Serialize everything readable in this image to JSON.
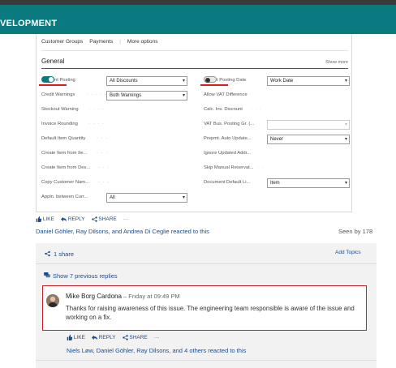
{
  "header": {
    "title": "VELOPMENT"
  },
  "card": {
    "tabs": [
      "Customer Groups",
      "Payments",
      "More options"
    ],
    "section_title": "General",
    "show_more": "Show more",
    "left_fields": [
      {
        "label": "nt Posting",
        "value": "All Discounts",
        "type": "toggle-dropdown"
      },
      {
        "label": "Credit Warnings",
        "value": "Both Warnings",
        "type": "dropdown"
      },
      {
        "label": "Stockout Warning",
        "value": "",
        "type": "none"
      },
      {
        "label": "Invoice Rounding",
        "value": "",
        "type": "none"
      },
      {
        "label": "Default Item Quantity",
        "value": "",
        "type": "none"
      },
      {
        "label": "Create Item from Ite...",
        "value": "",
        "type": "none"
      },
      {
        "label": "Create Item from Des...",
        "value": "",
        "type": "none"
      },
      {
        "label": "Copy Customer Nam...",
        "value": "",
        "type": "none"
      },
      {
        "label": "Appln. between Curr...",
        "value": "All",
        "type": "dropdown"
      }
    ],
    "right_fields": [
      {
        "label": "t Posting Date",
        "value": "Work Date",
        "type": "toggle-dropdown"
      },
      {
        "label": "Allow VAT Difference",
        "value": "",
        "type": "none"
      },
      {
        "label": "Calc. Inv. Discount",
        "value": "",
        "type": "none"
      },
      {
        "label": "VAT Bus. Posting Gr. (...",
        "value": "",
        "type": "dropdown-disabled"
      },
      {
        "label": "Prepmt. Auto Update...",
        "value": "Never",
        "type": "dropdown"
      },
      {
        "label": "Ignore Updated Addr...",
        "value": "",
        "type": "none"
      },
      {
        "label": "Skip Manual Reservat...",
        "value": "",
        "type": "none"
      },
      {
        "label": "Document Default Li...",
        "value": "Item",
        "type": "dropdown"
      }
    ]
  },
  "post": {
    "actions": {
      "like": "LIKE",
      "reply": "REPLY",
      "share": "SHARE",
      "more": "···"
    },
    "reacted": "Daniel Göhler, Ray Dilsons, and Andrea Di Ceglie reacted to this",
    "seen_by": "Seen by 178"
  },
  "panel": {
    "share_count": "1 share",
    "add_topics": "Add Topics",
    "show_previous": "Show 7 previous replies"
  },
  "comment": {
    "author": "Mike Borg Cardona",
    "time": " – Friday at 09:49 PM",
    "text": "Thanks for raising awareness of this issue. The engineering team responsible is aware of the issue and working on a fix.",
    "actions": {
      "like": "LIKE",
      "reply": "REPLY",
      "share": "SHARE",
      "more": "···"
    },
    "reacted": "Niels Løw, Daniel Göhler, Ray Dilsons, and 4 others reacted to this"
  },
  "colors": {
    "teal": "#0a7a80",
    "link": "#1a4c8c",
    "highlight_red": "#c8202b"
  }
}
